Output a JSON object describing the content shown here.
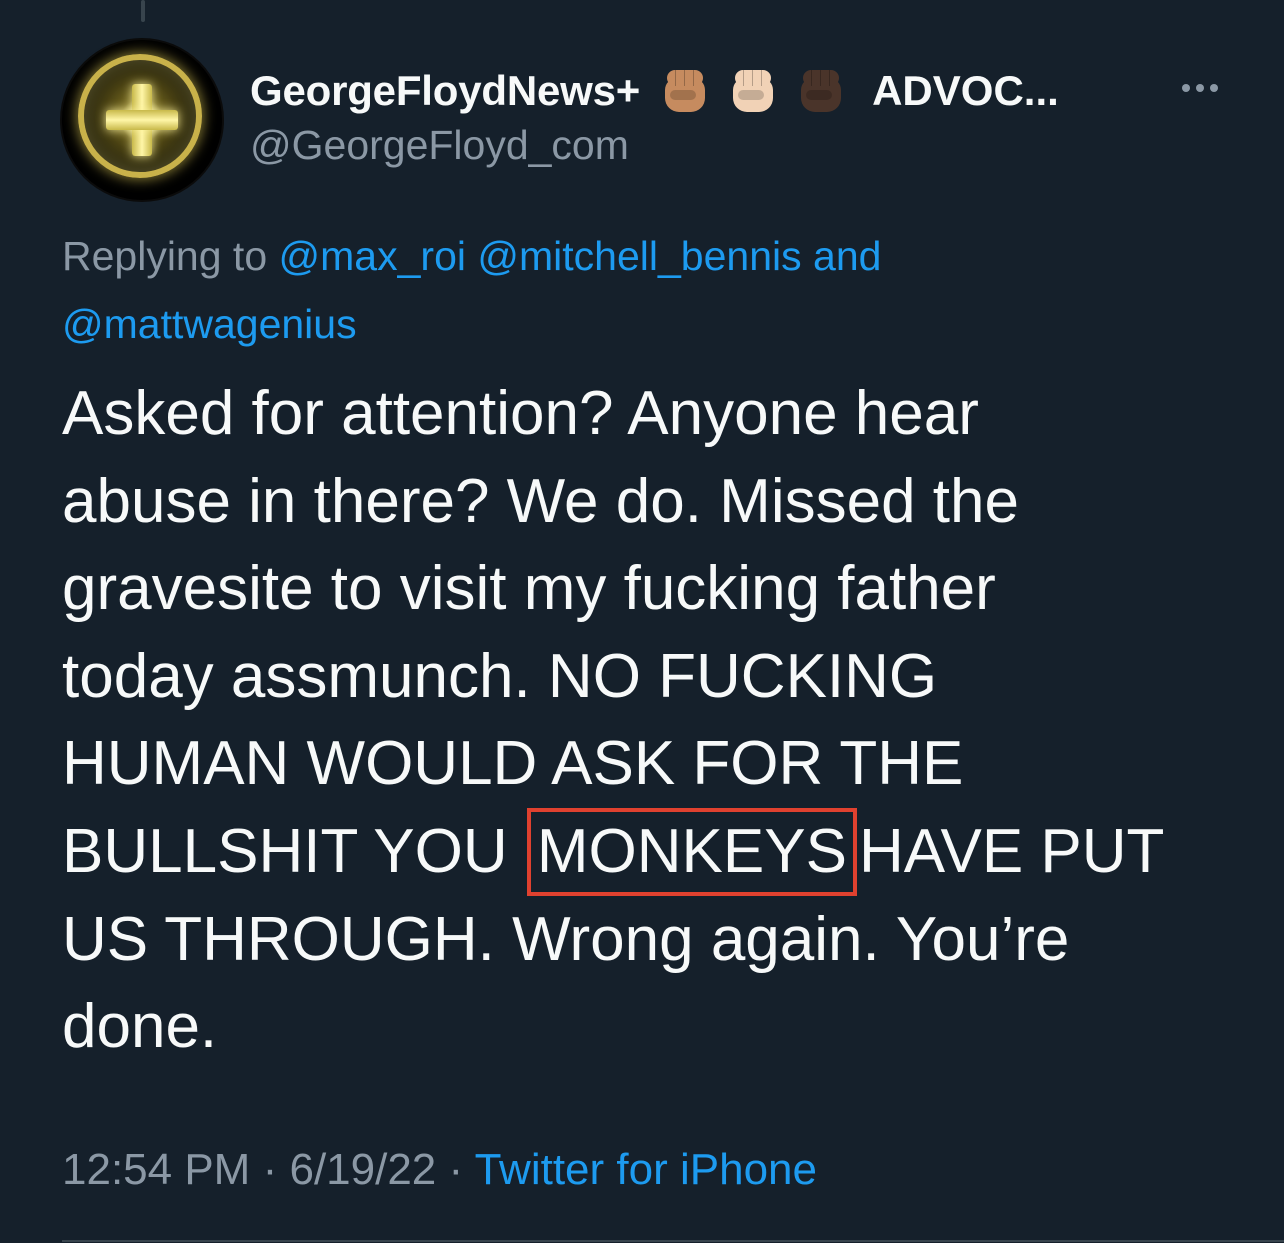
{
  "tweet": {
    "author": {
      "display_name": "GeorgeFloydNews+",
      "name_suffix": "ADVOC...",
      "handle": "@GeorgeFloyd_com",
      "emoji": [
        {
          "icon": "raised-fist-icon",
          "tone": "#c68b5f"
        },
        {
          "icon": "raised-fist-icon",
          "tone": "#f1d2b6"
        },
        {
          "icon": "raised-fist-icon",
          "tone": "#4a342a"
        }
      ]
    },
    "reply": {
      "prefix": "Replying to",
      "mention_1": "@max_roi",
      "mention_2": "@mitchell_bennis",
      "conjunction": "and",
      "mention_3": "@mattwagenius"
    },
    "body": {
      "line_1": "Asked for attention? Anyone hear",
      "line_2": "abuse in there? We do. Missed the",
      "line_3": "gravesite to visit my fucking father",
      "line_4": "today assmunch. NO FUCKING",
      "line_5": "HUMAN WOULD ASK FOR THE",
      "line_6_pre": "BULLSHIT YOU",
      "line_6_highlight": "MONKEYS",
      "line_6_post": "HAVE PUT",
      "line_7": "US THROUGH. Wrong again. You’re",
      "line_8": "done."
    },
    "meta": {
      "time": "12:54 PM",
      "separator": "·",
      "date": "6/19/22",
      "source": "Twitter for iPhone"
    }
  },
  "colors": {
    "background": "#15202b",
    "primary_text": "#f7f9f9",
    "secondary_text": "#8b98a5",
    "link": "#1d9bf0",
    "highlight_box": "#e0412f"
  }
}
